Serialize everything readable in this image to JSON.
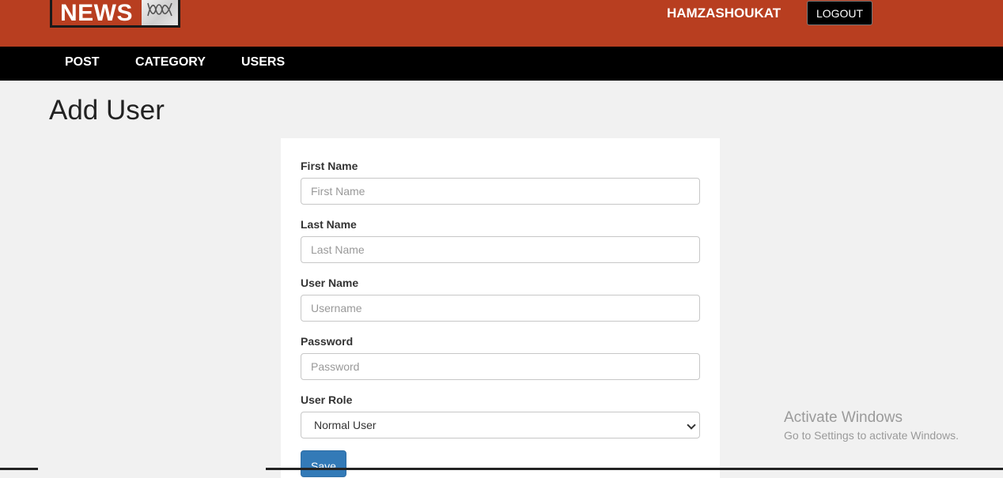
{
  "header": {
    "logo_text": "NEWS",
    "logo_mark": "abc-logo-icon",
    "username": "HAMZASHOUKAT",
    "logout_label": "LOGOUT"
  },
  "nav": {
    "items": [
      {
        "label": "POST"
      },
      {
        "label": "CATEGORY"
      },
      {
        "label": "USERS"
      }
    ]
  },
  "page": {
    "title": "Add User"
  },
  "form": {
    "first_name": {
      "label": "First Name",
      "placeholder": "First Name",
      "value": ""
    },
    "last_name": {
      "label": "Last Name",
      "placeholder": "Last Name",
      "value": ""
    },
    "user_name": {
      "label": "User Name",
      "placeholder": "Username",
      "value": ""
    },
    "password": {
      "label": "Password",
      "placeholder": "Password",
      "value": ""
    },
    "role": {
      "label": "User Role",
      "selected": "Normal User"
    },
    "save_label": "Save"
  },
  "watermark": {
    "title": "Activate Windows",
    "subtitle": "Go to Settings to activate Windows."
  },
  "colors": {
    "header_bg": "#b83e20",
    "nav_bg": "#000000",
    "page_bg": "#f1f1f1",
    "primary": "#337ab7"
  }
}
